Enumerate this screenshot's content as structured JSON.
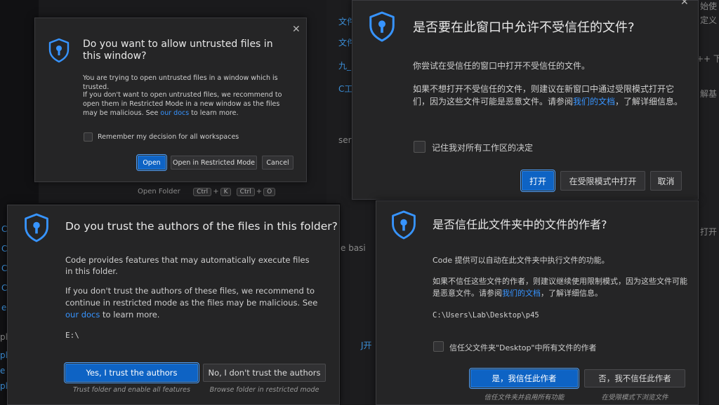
{
  "background": {
    "open_folder_label": "Open Folder",
    "keys_1": [
      "Ctrl",
      "K"
    ],
    "keys_2": [
      "Ctrl",
      "O"
    ],
    "fragments_top_right": [
      "始使",
      "定义",
      "++ 下",
      "解基",
      "打开"
    ],
    "fragments_mid": [
      "文件",
      "文件",
      "九_",
      "C工作",
      "sers",
      "e basi",
      "J开"
    ],
    "fragments_left": [
      "C",
      "C",
      "C",
      "C",
      "e",
      "pl",
      "pl",
      "e",
      "pl"
    ]
  },
  "dialog_en_window": {
    "title": "Do you want to allow untrusted files in this window?",
    "para1": "You are trying to open untrusted files in a window which is trusted.",
    "para2_pre": "If you don't want to open untrusted files, we recommend to open them in Restricted Mode in a new window as the files may be malicious. See ",
    "para2_link": "our docs",
    "para2_post": " to learn more.",
    "checkbox_label": "Remember my decision for all workspaces",
    "open_label": "Open",
    "restricted_label": "Open in Restricted Mode",
    "cancel_label": "Cancel"
  },
  "dialog_zh_window": {
    "title": "是否要在此窗口中允许不受信任的文件?",
    "para1": "你尝试在受信任的窗口中打开不受信任的文件。",
    "para2_pre": "如果不想打开不受信任的文件，则建议在新窗口中通过受限模式打开它们，因为这些文件可能是恶意文件。请参阅",
    "para2_link": "我们的文档",
    "para2_post": "，了解详细信息。",
    "checkbox_label": "记住我对所有工作区的决定",
    "open_label": "打开",
    "restricted_label": "在受限模式中打开",
    "cancel_label": "取消"
  },
  "dialog_en_folder": {
    "title": "Do you trust the authors of the files in this folder?",
    "para1": "Code provides features that may automatically execute files in this folder.",
    "para2_pre": "If you don't trust the authors of these files, we recommend to continue in restricted mode as the files may be malicious. See ",
    "para2_link": "our docs",
    "para2_post": " to learn more.",
    "path": "E:\\",
    "trust_label": "Yes, I trust the authors",
    "trust_hint": "Trust folder and enable all features",
    "notrust_label": "No, I don't trust the authors",
    "notrust_hint": "Browse folder in restricted mode"
  },
  "dialog_zh_folder": {
    "title": "是否信任此文件夹中的文件的作者?",
    "para1": "Code 提供可以自动在此文件夹中执行文件的功能。",
    "para2_pre": "如果不信任这些文件的作者，则建议继续使用限制模式，因为这些文件可能是恶意文件。请参阅",
    "para2_link": "我们的文档",
    "para2_post": "，了解详细信息。",
    "path": "C:\\Users\\Lab\\Desktop\\p45",
    "checkbox_label": "信任父文件夹\"Desktop\"中所有文件的作者",
    "trust_label": "是，我信任此作者",
    "trust_hint": "信任文件夹并启用所有功能",
    "notrust_label": "否，我不信任此作者",
    "notrust_hint": "在受限模式下浏览文件"
  },
  "colors": {
    "accent": "#0e63c4",
    "link": "#3794ff",
    "dialog_bg": "#252526",
    "shield": "#3794ff"
  }
}
